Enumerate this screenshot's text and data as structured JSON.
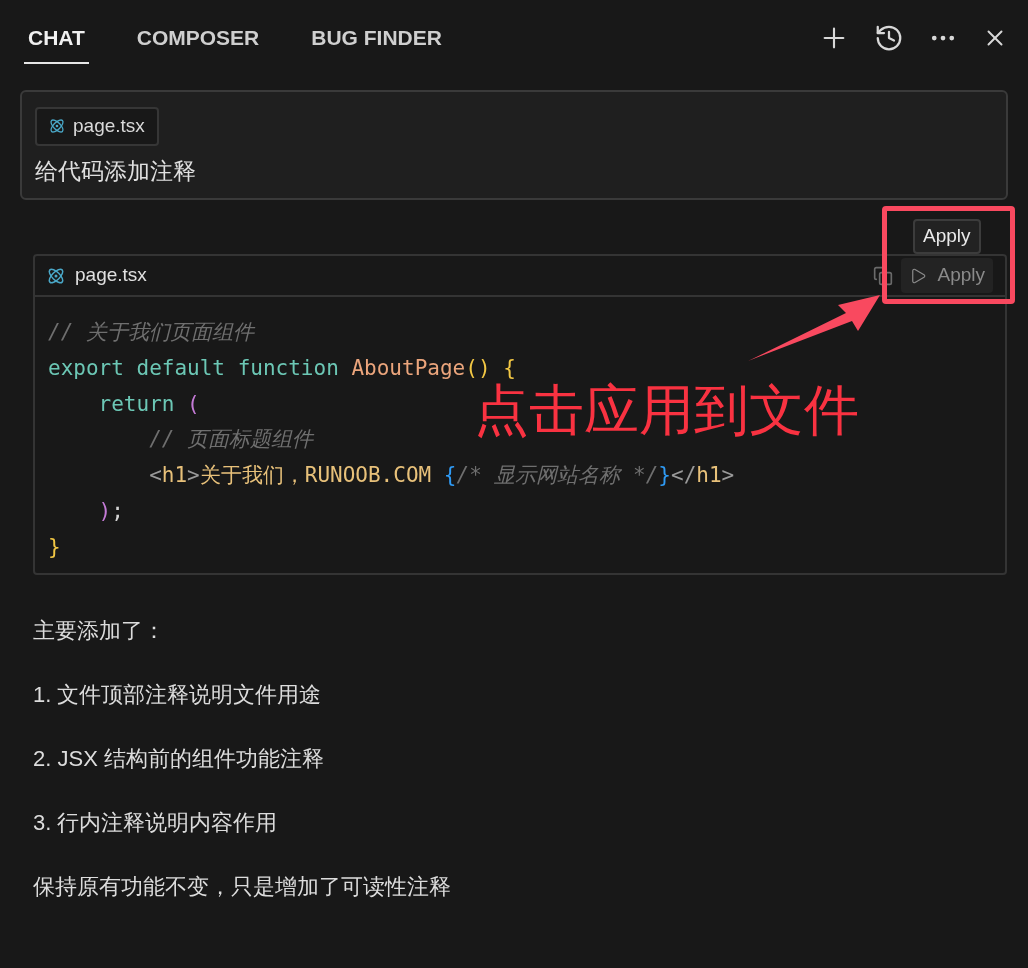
{
  "tabs": [
    {
      "label": "CHAT",
      "selected": true
    },
    {
      "label": "COMPOSER",
      "selected": false
    },
    {
      "label": "BUG FINDER",
      "selected": false
    }
  ],
  "prompt": {
    "file_chip": "page.tsx",
    "text": "给代码添加注释"
  },
  "code_block": {
    "filename": "page.tsx",
    "tooltip": "Apply",
    "apply_label": "Apply",
    "lines": [
      [
        {
          "kind": "comment",
          "text": "// 关于我们页面组件"
        }
      ],
      [
        {
          "kind": "keyword",
          "text": "export default function "
        },
        {
          "kind": "function",
          "text": "AboutPage"
        },
        {
          "kind": "bracket",
          "text": "() {"
        }
      ],
      [
        {
          "kind": "keyword",
          "text": "    return "
        },
        {
          "kind": "paren",
          "text": "("
        }
      ],
      [
        {
          "kind": "comment",
          "text": "        // 页面标题组件"
        }
      ],
      [
        {
          "kind": "punct",
          "text": "        <"
        },
        {
          "kind": "tag",
          "text": "h1"
        },
        {
          "kind": "punct",
          "text": ">"
        },
        {
          "kind": "string",
          "text": "关于我们，RUNOOB.COM "
        },
        {
          "kind": "brace",
          "text": "{"
        },
        {
          "kind": "comment",
          "text": "/* 显示网站名称 */"
        },
        {
          "kind": "brace",
          "text": "}"
        },
        {
          "kind": "punct",
          "text": "</"
        },
        {
          "kind": "tag",
          "text": "h1"
        },
        {
          "kind": "punct",
          "text": ">"
        }
      ],
      [
        {
          "kind": "paren",
          "text": "    )"
        },
        {
          "kind": "plain",
          "text": ";"
        }
      ],
      [
        {
          "kind": "bracket",
          "text": "}"
        }
      ]
    ]
  },
  "annotation": {
    "text": "点击应用到文件"
  },
  "response": [
    "主要添加了：",
    "1. 文件顶部注释说明文件用途",
    "2. JSX 结构前的组件功能注释",
    "3. 行内注释说明内容作用",
    "保持原有功能不变，只是增加了可读性注释"
  ]
}
